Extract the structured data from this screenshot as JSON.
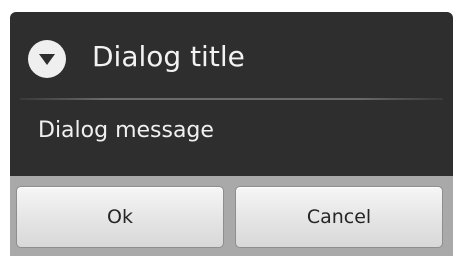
{
  "dialog": {
    "title": "Dialog title",
    "title_icon": "chevron-down-circle-icon",
    "message": "Dialog message",
    "buttons": {
      "ok_label": "Ok",
      "cancel_label": "Cancel"
    }
  },
  "colors": {
    "dialog_background": "#2e2e2e",
    "button_bar_background": "#a9a9a9",
    "button_face": "#e3e3e3",
    "title_text": "#f2f2f2"
  }
}
